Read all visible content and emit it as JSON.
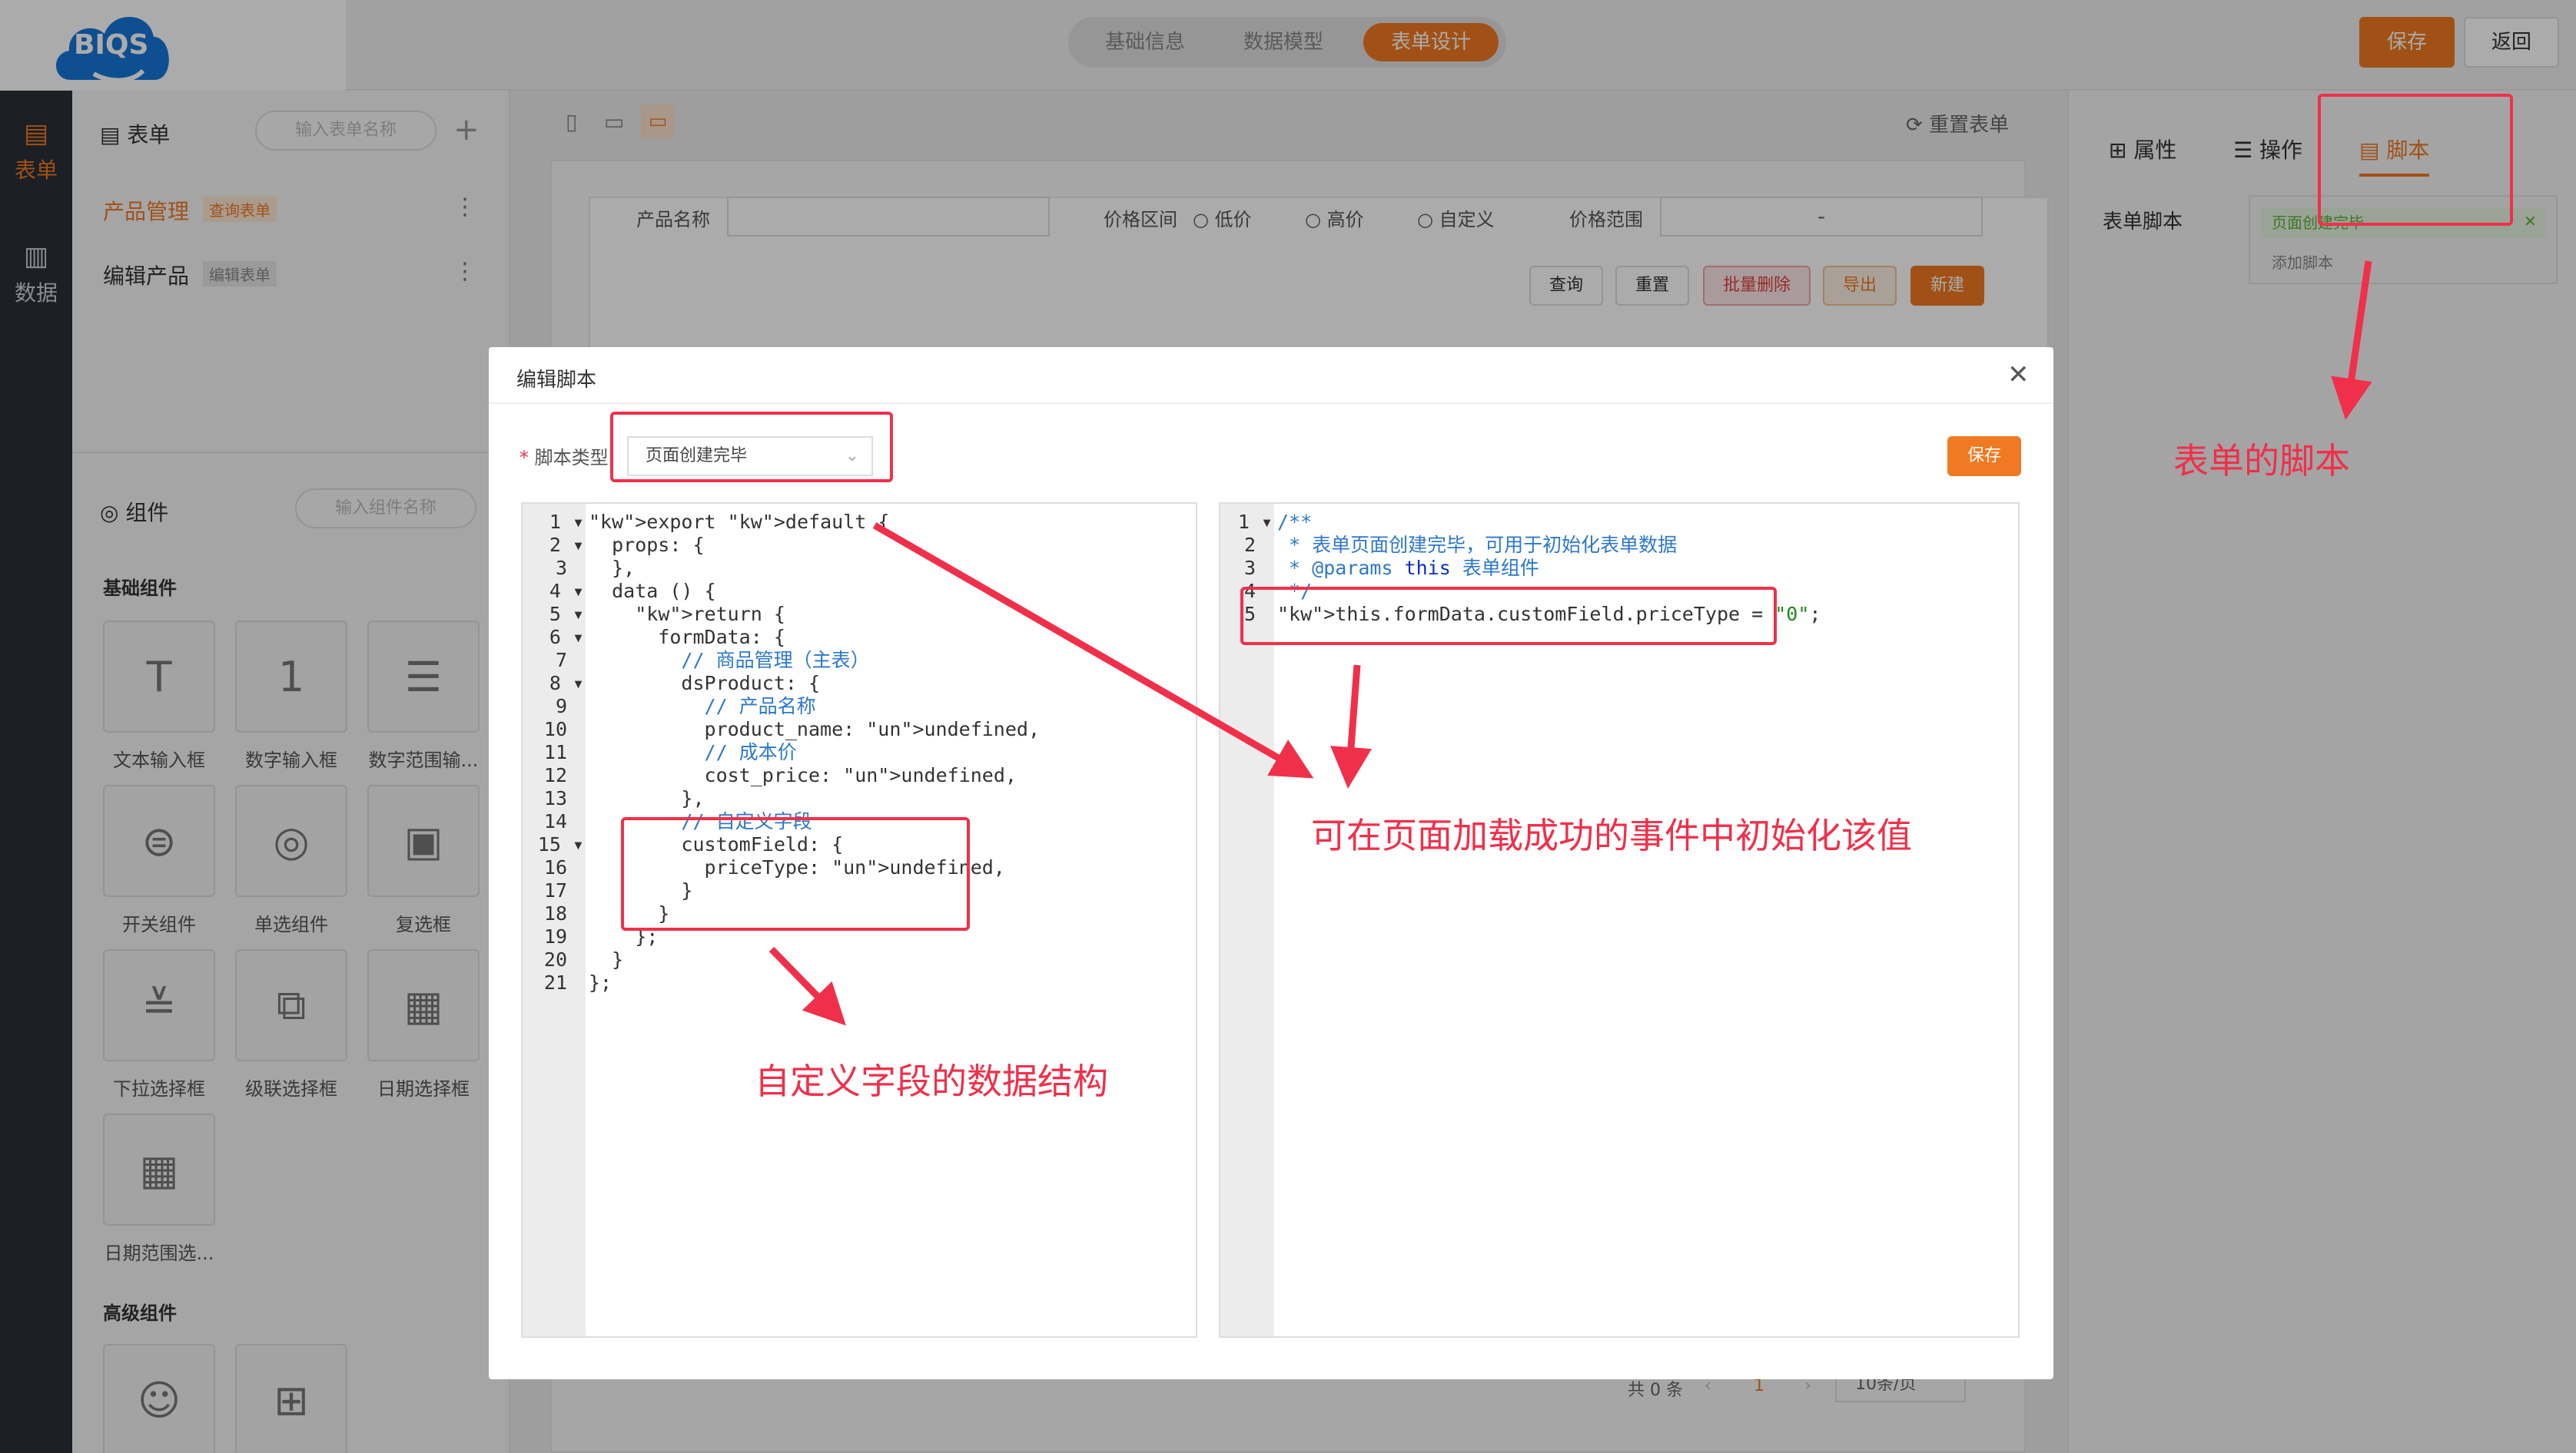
{
  "app": {
    "logo_text": "BIQS"
  },
  "rail": {
    "items": [
      {
        "label": "表单",
        "active": true
      },
      {
        "label": "数据",
        "active": false
      }
    ]
  },
  "top_tabs": [
    {
      "label": "基础信息"
    },
    {
      "label": "数据模型"
    },
    {
      "label": "表单设计"
    }
  ],
  "top_actions": {
    "save": "保存",
    "back": "返回"
  },
  "left_panel": {
    "forms_title": "表单",
    "forms_search_placeholder": "输入表单名称",
    "forms": [
      {
        "name": "产品管理",
        "tag": "查询表单"
      },
      {
        "name": "编辑产品",
        "tag": "编辑表单"
      }
    ],
    "components_title": "组件",
    "components_search_placeholder": "输入组件名称",
    "basic_title": "基础组件",
    "basic": [
      "文本输入框",
      "数字输入框",
      "数字范围输...",
      "开关组件",
      "单选组件",
      "复选框",
      "下拉选择框",
      "级联选择框",
      "日期选择框",
      "日期范围选..."
    ],
    "advanced_title": "高级组件"
  },
  "canvas": {
    "reset_label": "重置表单",
    "fields": {
      "product_name": "产品名称",
      "price_range": "价格区间",
      "low": "低价",
      "high": "高价",
      "custom": "自定义",
      "price_scope": "价格范围",
      "range_sep": "-"
    },
    "buttons": {
      "query": "查询",
      "reset": "重置",
      "batch_delete": "批量删除",
      "export": "导出",
      "create": "新建"
    },
    "pagination": {
      "total": "共 0 条",
      "page": "1",
      "page_size": "10条/页"
    }
  },
  "right_panel": {
    "tabs": [
      "属性",
      "操作",
      "脚本"
    ],
    "script_label": "表单脚本",
    "script_item": "页面创建完毕",
    "add_script": "添加脚本"
  },
  "modal": {
    "title": "编辑脚本",
    "type_label": "脚本类型",
    "type_value": "页面创建完毕",
    "save": "保存",
    "left_code": [
      "export default {",
      "  props: {",
      "  },",
      "  data () {",
      "    return {",
      "      formData: {",
      "        // 商品管理（主表）",
      "        dsProduct: {",
      "          // 产品名称",
      "          product_name: undefined,",
      "          // 成本价",
      "          cost_price: undefined,",
      "        },",
      "        // 自定义字段",
      "        customField: {",
      "          priceType: undefined,",
      "        }",
      "      }",
      "    };",
      "  }",
      "};"
    ],
    "right_code": [
      "/**",
      " * 表单页面创建完毕，可用于初始化表单数据",
      " * @params this 表单组件",
      " */",
      "this.formData.customField.priceType = \"0\";"
    ]
  },
  "annotations": {
    "form_script": "表单的脚本",
    "init_value": "可在页面加载成功的事件中初始化该值",
    "structure": "自定义字段的数据结构"
  },
  "colors": {
    "accent": "#f07a22",
    "annotation": "#f0304a"
  }
}
